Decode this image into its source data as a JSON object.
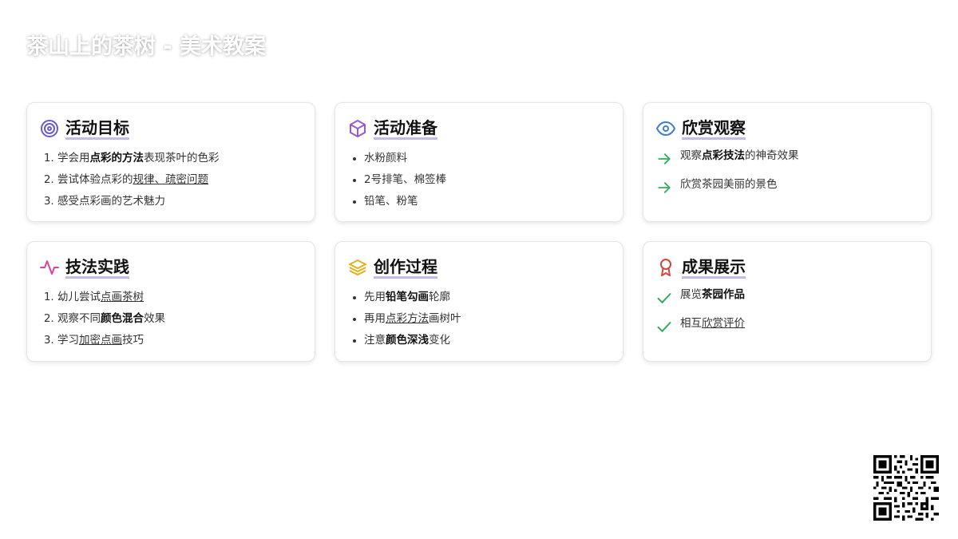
{
  "page": {
    "title": "茶山上的茶树 - 美术教案"
  },
  "cards": {
    "goals": {
      "title": "活动目标",
      "icon": "target-icon",
      "items": [
        {
          "a": "学会用",
          "b": "点彩的方法",
          "c": "表现茶叶的色彩"
        },
        {
          "a": "尝试体验点彩的",
          "u": "规律、疏密问题"
        },
        {
          "a": "感受点彩画的艺术魅力"
        }
      ]
    },
    "prep": {
      "title": "活动准备",
      "icon": "cube-icon",
      "items": [
        "水粉颜料",
        "2号排笔、棉签棒",
        "铅笔、粉笔"
      ]
    },
    "observe": {
      "title": "欣赏观察",
      "icon": "eye-icon",
      "items": [
        {
          "a": "观察",
          "b": "点彩技法",
          "c": "的神奇效果"
        },
        {
          "a": "欣赏茶园美丽的景色"
        }
      ]
    },
    "practice": {
      "title": "技法实践",
      "icon": "activity-icon",
      "items": [
        {
          "a": "幼儿尝试",
          "u": "点画茶树"
        },
        {
          "a": "观察不同",
          "b": "颜色混合",
          "c": "效果"
        },
        {
          "a": "学习",
          "u": "加密点画",
          "c": "技巧"
        }
      ]
    },
    "create": {
      "title": "创作过程",
      "icon": "layers-icon",
      "items": [
        {
          "a": "先用",
          "b": "铅笔勾画",
          "c": "轮廓"
        },
        {
          "a": "再用",
          "u": "点彩方法",
          "c": "画树叶"
        },
        {
          "a": "注意",
          "b": "颜色深浅",
          "c": "变化"
        }
      ]
    },
    "result": {
      "title": "成果展示",
      "icon": "award-icon",
      "items": [
        {
          "a": "展览",
          "b": "茶园作品"
        },
        {
          "a": "相互",
          "u": "欣赏评价"
        }
      ]
    }
  },
  "colors": {
    "target": "#6a5acd",
    "cube": "#9b59d0",
    "eye": "#3f7fd0",
    "activity": "#d6479b",
    "layers": "#e0b21e",
    "award": "#d9433f",
    "arrow": "#2fae5a",
    "check": "#2fae5a",
    "title_underline": "#c3bde3"
  }
}
